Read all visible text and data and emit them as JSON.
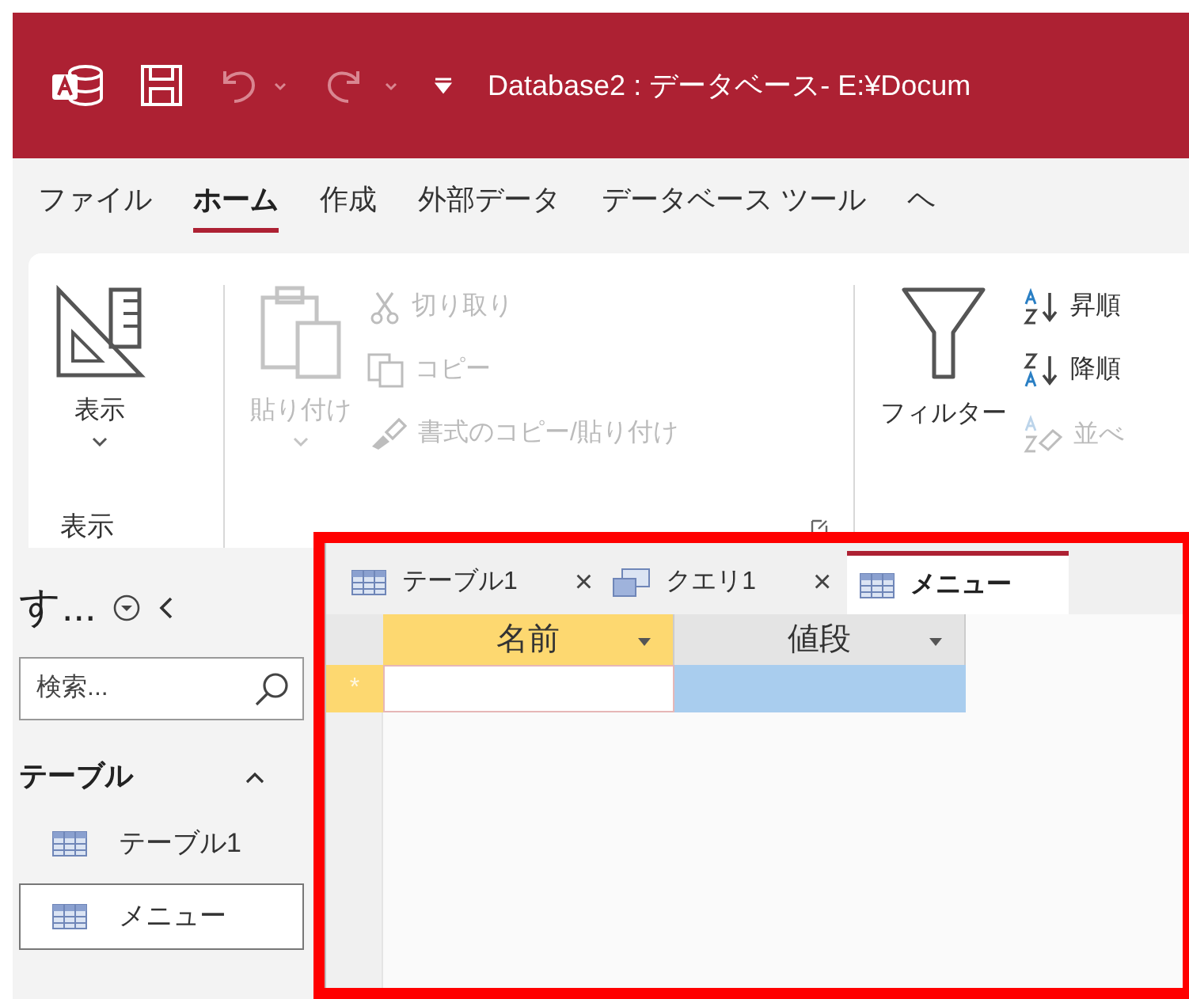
{
  "title_bar": {
    "title": "Database2 : データベース- E:¥Docum"
  },
  "ribbon_tabs": [
    {
      "label": "ファイル",
      "selected": false
    },
    {
      "label": "ホーム",
      "selected": true
    },
    {
      "label": "作成",
      "selected": false
    },
    {
      "label": "外部データ",
      "selected": false
    },
    {
      "label": "データベース ツール",
      "selected": false
    },
    {
      "label": "ヘ",
      "selected": false
    }
  ],
  "ribbon_groups": [
    {
      "label": "表示",
      "launcher": false,
      "large": {
        "label": "表示",
        "disabled": false,
        "dropdown": true
      }
    },
    {
      "launcher": true,
      "large": {
        "label": "貼り付け",
        "disabled": true,
        "dropdown": true
      },
      "small": [
        {
          "label": "切り取り",
          "disabled": true
        },
        {
          "label": "コピー",
          "disabled": true
        },
        {
          "label": "書式のコピー/貼り付け",
          "disabled": true
        }
      ]
    },
    {
      "launcher": false,
      "large": {
        "label": "フィルター",
        "disabled": false,
        "dropdown": false
      },
      "small": [
        {
          "label": "昇順",
          "disabled": false
        },
        {
          "label": "降順",
          "disabled": false
        },
        {
          "label": "並べ",
          "disabled": true
        }
      ]
    }
  ],
  "nav_pane": {
    "title": "す...",
    "search": {
      "placeholder": "検索..."
    },
    "section": {
      "label": "テーブル",
      "expanded": true
    },
    "items": [
      {
        "label": "テーブル1",
        "selected": false
      },
      {
        "label": "メニュー",
        "selected": true
      }
    ]
  },
  "doc_tabs": [
    {
      "label": "テーブル1",
      "kind": "table",
      "selected": false,
      "close": "×"
    },
    {
      "label": "クエリ1",
      "kind": "query",
      "selected": false,
      "close": "×"
    },
    {
      "label": "メニュー",
      "kind": "table",
      "selected": true
    }
  ],
  "datasheet": {
    "columns": [
      {
        "label": "名前",
        "current": true
      },
      {
        "label": "値段",
        "current": false
      }
    ],
    "new_row_marker": "*"
  }
}
